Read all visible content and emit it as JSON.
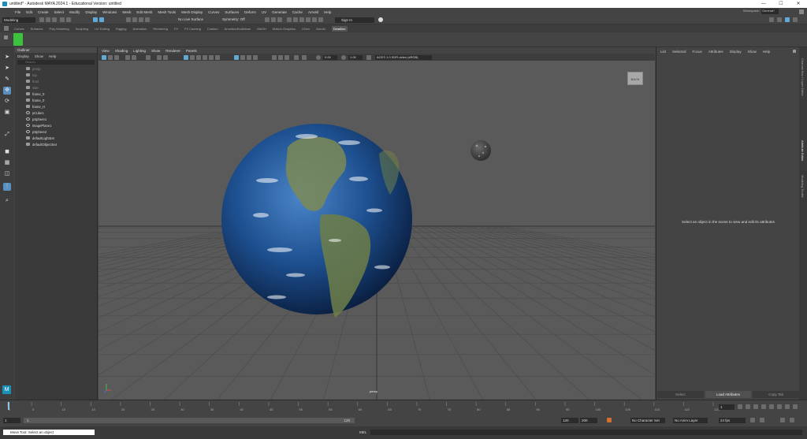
{
  "window": {
    "title": "untitled* - Autodesk MAYA 2024.1 - Educational Version: untitled",
    "minimize": "—",
    "maximize": "☐",
    "close": "✕"
  },
  "menubar": {
    "items": [
      "File",
      "Edit",
      "Create",
      "Select",
      "Modify",
      "Display",
      "Windows",
      "Mesh",
      "Edit Mesh",
      "Mesh Tools",
      "Mesh Display",
      "Curves",
      "Surfaces",
      "Deform",
      "UV",
      "Generate",
      "Cache",
      "Arnold",
      "Help"
    ],
    "workspace_label": "Workspace:",
    "workspace_value": "General*"
  },
  "statusline": {
    "mode": "Modeling",
    "live_surface": "No Live Surface",
    "symmetry": "Symmetry: Off",
    "sign_in": "Sign In"
  },
  "shelf_tabs": {
    "items": [
      "Curves",
      "Surfaces",
      "Poly Modeling",
      "Sculpting",
      "UV Editing",
      "Rigging",
      "Animation",
      "Rendering",
      "FX",
      "FX Caching",
      "Custom",
      "ArnoldonEuclidean",
      "MASH",
      "Motion Graphics",
      "XGen",
      "Arnold",
      "Deadline"
    ],
    "active": "Deadline"
  },
  "outliner": {
    "title": "Outliner",
    "menu": [
      "Display",
      "Show",
      "Help"
    ],
    "search_placeholder": "Search...",
    "items": [
      {
        "label": "persp",
        "dim": true
      },
      {
        "label": "top",
        "dim": true
      },
      {
        "label": "front",
        "dim": true
      },
      {
        "label": "side",
        "dim": true
      },
      {
        "label": "frame_0",
        "dim": false
      },
      {
        "label": "frame_0",
        "dim": false
      },
      {
        "label": "frame_H",
        "dim": false
      },
      {
        "label": "pCube1",
        "dim": false
      },
      {
        "label": "pSphere1",
        "dim": false
      },
      {
        "label": "imagePlane1",
        "dim": false
      },
      {
        "label": "pSphere2",
        "dim": false
      },
      {
        "label": "defaultLightSet",
        "dim": false
      },
      {
        "label": "defaultObjectSet",
        "dim": false
      }
    ]
  },
  "viewport": {
    "menu": [
      "View",
      "Shading",
      "Lighting",
      "Show",
      "Renderer",
      "Panels"
    ],
    "field_a": "0.00",
    "field_b": "1.00",
    "colorspace": "ACES 1.0 SDR-video (sRGB)",
    "camera": "persp",
    "viewcube": "BACK"
  },
  "attribute_editor": {
    "menu": [
      "List",
      "Selected",
      "Focus",
      "Attributes",
      "Display",
      "Show",
      "Help"
    ],
    "message": "Select an object in the scene to view and edit its attributes",
    "buttons": [
      "Select",
      "Load Attributes",
      "Copy Tab"
    ],
    "side_tabs": [
      "Channel Box / Layer Editor",
      "Attribute Editor",
      "Modeling Toolkit"
    ]
  },
  "timeline": {
    "ticks": [
      "1",
      "5",
      "10",
      "15",
      "20",
      "25",
      "30",
      "35",
      "40",
      "45",
      "50",
      "55",
      "60",
      "65",
      "70",
      "75",
      "80",
      "85",
      "90",
      "95",
      "100",
      "105",
      "110",
      "115",
      "120"
    ],
    "current_frame": "1",
    "range_start": "1",
    "range_inner_start": "1",
    "range_inner_end": "120",
    "range_end": "200",
    "playback_end": "120",
    "character_set": "No Character Set",
    "anim_layer": "No Anim Layer",
    "fps": "24 fps"
  },
  "commandline": {
    "lang": "MEL",
    "help": "Move Tool: Select an object"
  },
  "colors": {
    "accent": "#5fa8d8",
    "viewport_bg": "#5a5a5a",
    "panel_bg": "#444444"
  }
}
